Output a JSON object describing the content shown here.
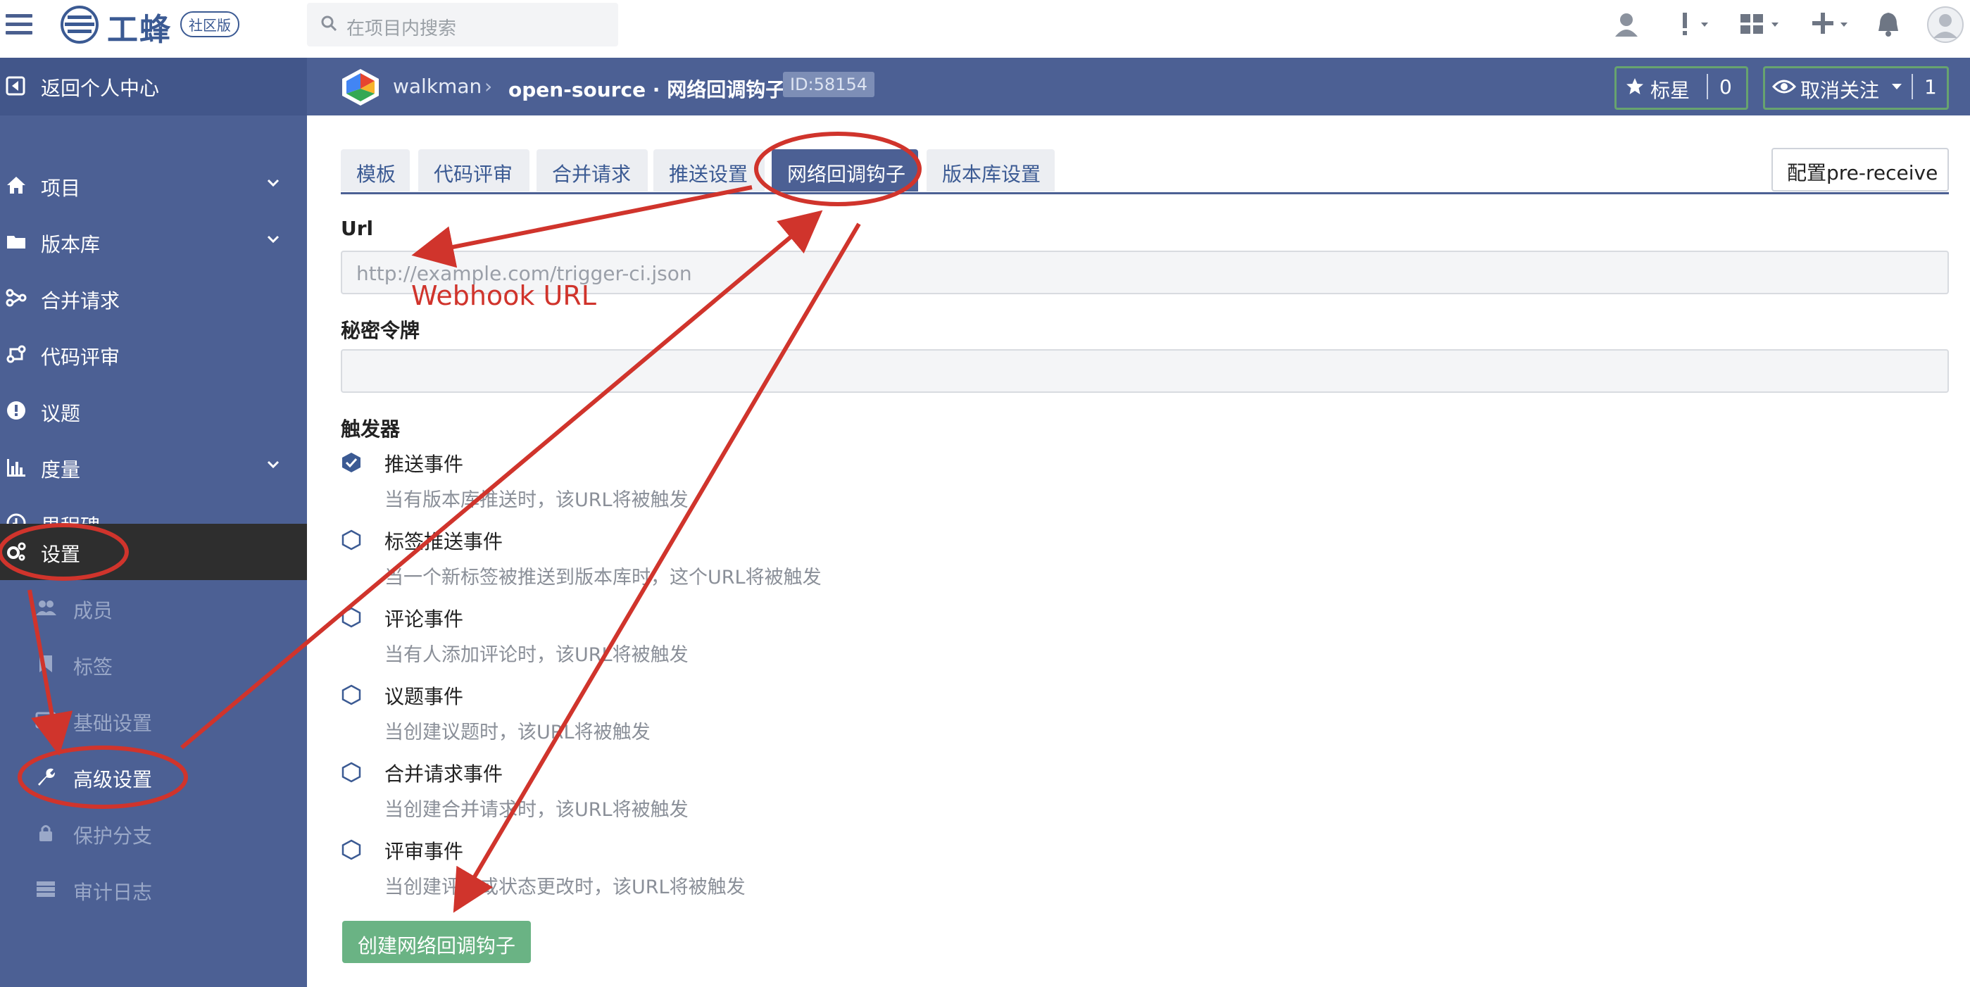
{
  "topbar": {
    "brand": "工蜂",
    "brand_badge": "社区版",
    "search_placeholder": "在项目内搜索",
    "icons": [
      "user-icon",
      "alert-icon",
      "apps-icon",
      "plus-icon",
      "bell-icon",
      "avatar"
    ]
  },
  "sidebar": {
    "back_label": "返回个人中心",
    "items": [
      {
        "label": "项目",
        "icon": "home-icon",
        "chevron": true
      },
      {
        "label": "版本库",
        "icon": "folder-icon",
        "chevron": true
      },
      {
        "label": "合并请求",
        "icon": "merge-icon",
        "chevron": false
      },
      {
        "label": "代码评审",
        "icon": "review-icon",
        "chevron": false
      },
      {
        "label": "议题",
        "icon": "issue-icon",
        "chevron": false
      },
      {
        "label": "度量",
        "icon": "chart-icon",
        "chevron": true
      },
      {
        "label": "里程碑",
        "icon": "clock-icon",
        "chevron": false
      },
      {
        "label": "设置",
        "icon": "gears-icon",
        "chevron": false
      }
    ],
    "subitems": [
      {
        "label": "成员",
        "icon": "users-icon"
      },
      {
        "label": "标签",
        "icon": "bookmark-icon"
      },
      {
        "label": "基础设置",
        "icon": "settings-card-icon"
      },
      {
        "label": "高级设置",
        "icon": "wrench-icon"
      },
      {
        "label": "保护分支",
        "icon": "lock-icon"
      },
      {
        "label": "审计日志",
        "icon": "log-icon"
      }
    ]
  },
  "breadcrumb": {
    "user": "walkman",
    "separator": "›",
    "project": "open-source · 网络回调钩子",
    "id": "ID:58154",
    "star_label": "标星",
    "star_count": "0",
    "watch_label": "取消关注",
    "watch_count": "1"
  },
  "tabs": [
    {
      "label": "模板"
    },
    {
      "label": "代码评审"
    },
    {
      "label": "合并请求"
    },
    {
      "label": "推送设置"
    },
    {
      "label": "网络回调钩子"
    },
    {
      "label": "版本库设置"
    }
  ],
  "pre_receive_button": "配置pre-receive",
  "form": {
    "url_label": "Url",
    "url_placeholder": "http://example.com/trigger-ci.json",
    "token_label": "秘密令牌",
    "token_value": "",
    "trigger_label": "触发器",
    "triggers": [
      {
        "name": "推送事件",
        "desc": "当有版本库推送时，该URL将被触发",
        "checked": true
      },
      {
        "name": "标签推送事件",
        "desc": "当一个新标签被推送到版本库时，这个URL将被触发",
        "checked": false
      },
      {
        "name": "评论事件",
        "desc": "当有人添加评论时，该URL将被触发",
        "checked": false
      },
      {
        "name": "议题事件",
        "desc": "当创建议题时，该URL将被触发",
        "checked": false
      },
      {
        "name": "合并请求事件",
        "desc": "当创建合并请求时，该URL将被触发",
        "checked": false
      },
      {
        "name": "评审事件",
        "desc": "当创建评论或状态更改时，该URL将被触发",
        "checked": false
      }
    ],
    "submit_label": "创建网络回调钩子"
  },
  "annotation": {
    "webhook_label": "Webhook URL",
    "color": "#d0342c"
  },
  "colors": {
    "primary": "#4c6094",
    "sidebar_active": "#2e2e2e",
    "success": "#6ab384"
  }
}
